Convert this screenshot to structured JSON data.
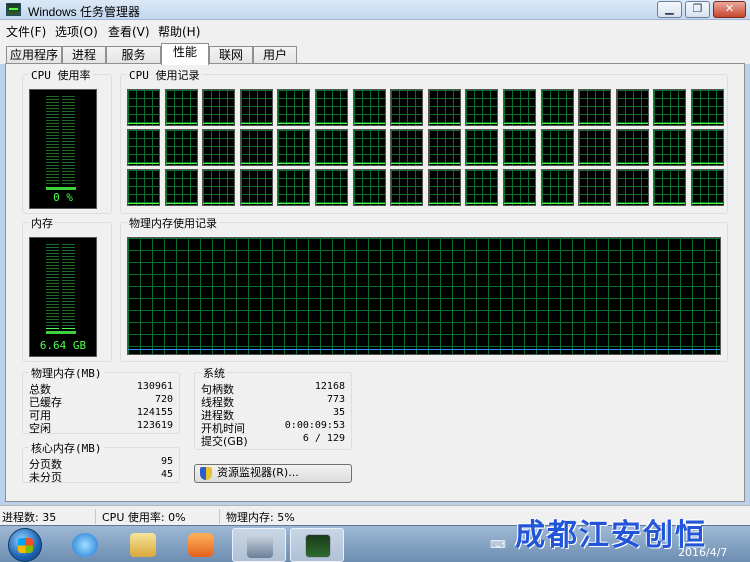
{
  "window": {
    "title": "Windows 任务管理器",
    "min_glyph": "▁",
    "max_glyph": "❐",
    "close_glyph": "✕"
  },
  "menu": [
    {
      "label": "文件(F)"
    },
    {
      "label": "选项(O)"
    },
    {
      "label": "查看(V)"
    },
    {
      "label": "帮助(H)"
    }
  ],
  "tabs": [
    {
      "label": "应用程序",
      "active": false
    },
    {
      "label": "进程",
      "active": false
    },
    {
      "label": "服务",
      "active": false
    },
    {
      "label": "性能",
      "active": true
    },
    {
      "label": "联网",
      "active": false
    },
    {
      "label": "用户",
      "active": false
    }
  ],
  "cpu": {
    "label": "CPU 使用率",
    "value_text": "0 %",
    "usage_fraction": 0.0
  },
  "cpu_history": {
    "label": "CPU 使用记录",
    "rows": 3,
    "cols": 16
  },
  "memory": {
    "label": "内存",
    "value_text": "6.64 GB",
    "usage_fraction": 0.05
  },
  "memory_history": {
    "label": "物理内存使用记录"
  },
  "physical_memory": {
    "label": "物理内存(MB)",
    "rows": [
      {
        "key": "总数",
        "value": "130961"
      },
      {
        "key": "已缓存",
        "value": "720"
      },
      {
        "key": "可用",
        "value": "124155"
      },
      {
        "key": "空闲",
        "value": "123619"
      }
    ]
  },
  "kernel_memory": {
    "label": "核心内存(MB)",
    "rows": [
      {
        "key": "分页数",
        "value": "95"
      },
      {
        "key": "未分页",
        "value": "45"
      }
    ]
  },
  "system": {
    "label": "系统",
    "rows": [
      {
        "key": "句柄数",
        "value": "12168"
      },
      {
        "key": "线程数",
        "value": "773"
      },
      {
        "key": "进程数",
        "value": "35"
      },
      {
        "key": "开机时间",
        "value": "0:00:09:53"
      },
      {
        "key": "提交(GB)",
        "value": "6 / 129"
      }
    ]
  },
  "resource_monitor_button": {
    "label": "资源监视器(R)..."
  },
  "statusbar": {
    "processes": "进程数: 35",
    "cpu": "CPU 使用率: 0%",
    "memory": "物理内存: 5%"
  },
  "taskbar": {
    "date": "2016/4/7",
    "watermark": "成都江安创恒"
  },
  "colors": {
    "meter_green": "#4cff4c",
    "grid_green": "#0b6e2c",
    "memory_trace": "#2d8cff"
  }
}
